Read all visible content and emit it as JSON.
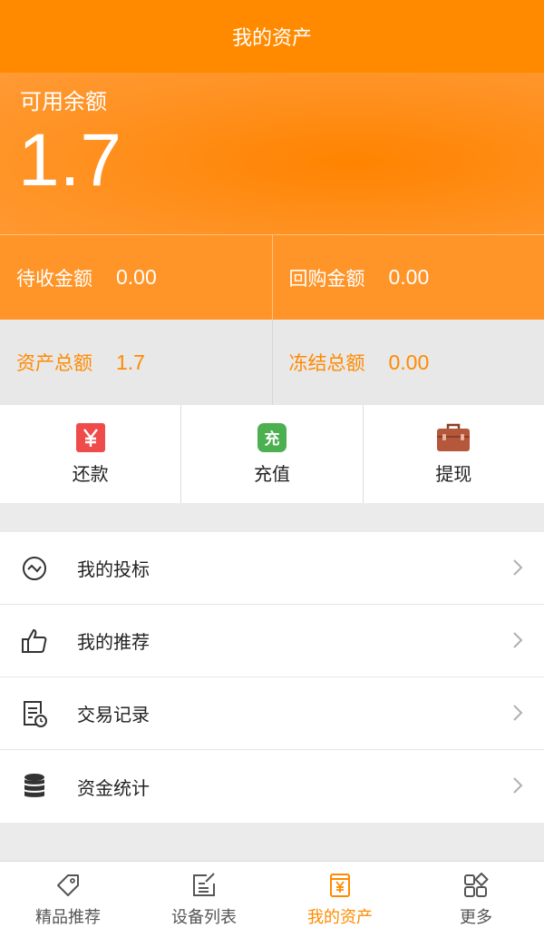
{
  "header": {
    "title": "我的资产"
  },
  "balance": {
    "label": "可用余额",
    "value": "1.7"
  },
  "stats": {
    "pending": {
      "label": "待收金额",
      "value": "0.00"
    },
    "buyback": {
      "label": "回购金额",
      "value": "0.00"
    },
    "total": {
      "label": "资产总额",
      "value": "1.7"
    },
    "frozen": {
      "label": "冻结总额",
      "value": "0.00"
    }
  },
  "actions": {
    "repay": {
      "label": "还款",
      "icon": "yen-icon",
      "color": "#f04b4b"
    },
    "recharge": {
      "label": "充值",
      "icon": "recharge-icon",
      "glyph": "充",
      "color": "#4caf50"
    },
    "withdraw": {
      "label": "提现",
      "icon": "briefcase-icon",
      "color": "#b5573a"
    }
  },
  "menu": [
    {
      "label": "我的投标",
      "icon": "trend-icon"
    },
    {
      "label": "我的推荐",
      "icon": "thumbs-up-icon"
    },
    {
      "label": "交易记录",
      "icon": "record-icon"
    },
    {
      "label": "资金统计",
      "icon": "coins-stack-icon"
    }
  ],
  "tabs": [
    {
      "label": "精品推荐",
      "icon": "tag-icon"
    },
    {
      "label": "设备列表",
      "icon": "edit-list-icon"
    },
    {
      "label": "我的资产",
      "icon": "asset-icon",
      "active": true
    },
    {
      "label": "更多",
      "icon": "grid-icon"
    }
  ],
  "colors": {
    "accent": "#ff8a00",
    "text": "#222222",
    "tab_inactive": "#555555"
  }
}
